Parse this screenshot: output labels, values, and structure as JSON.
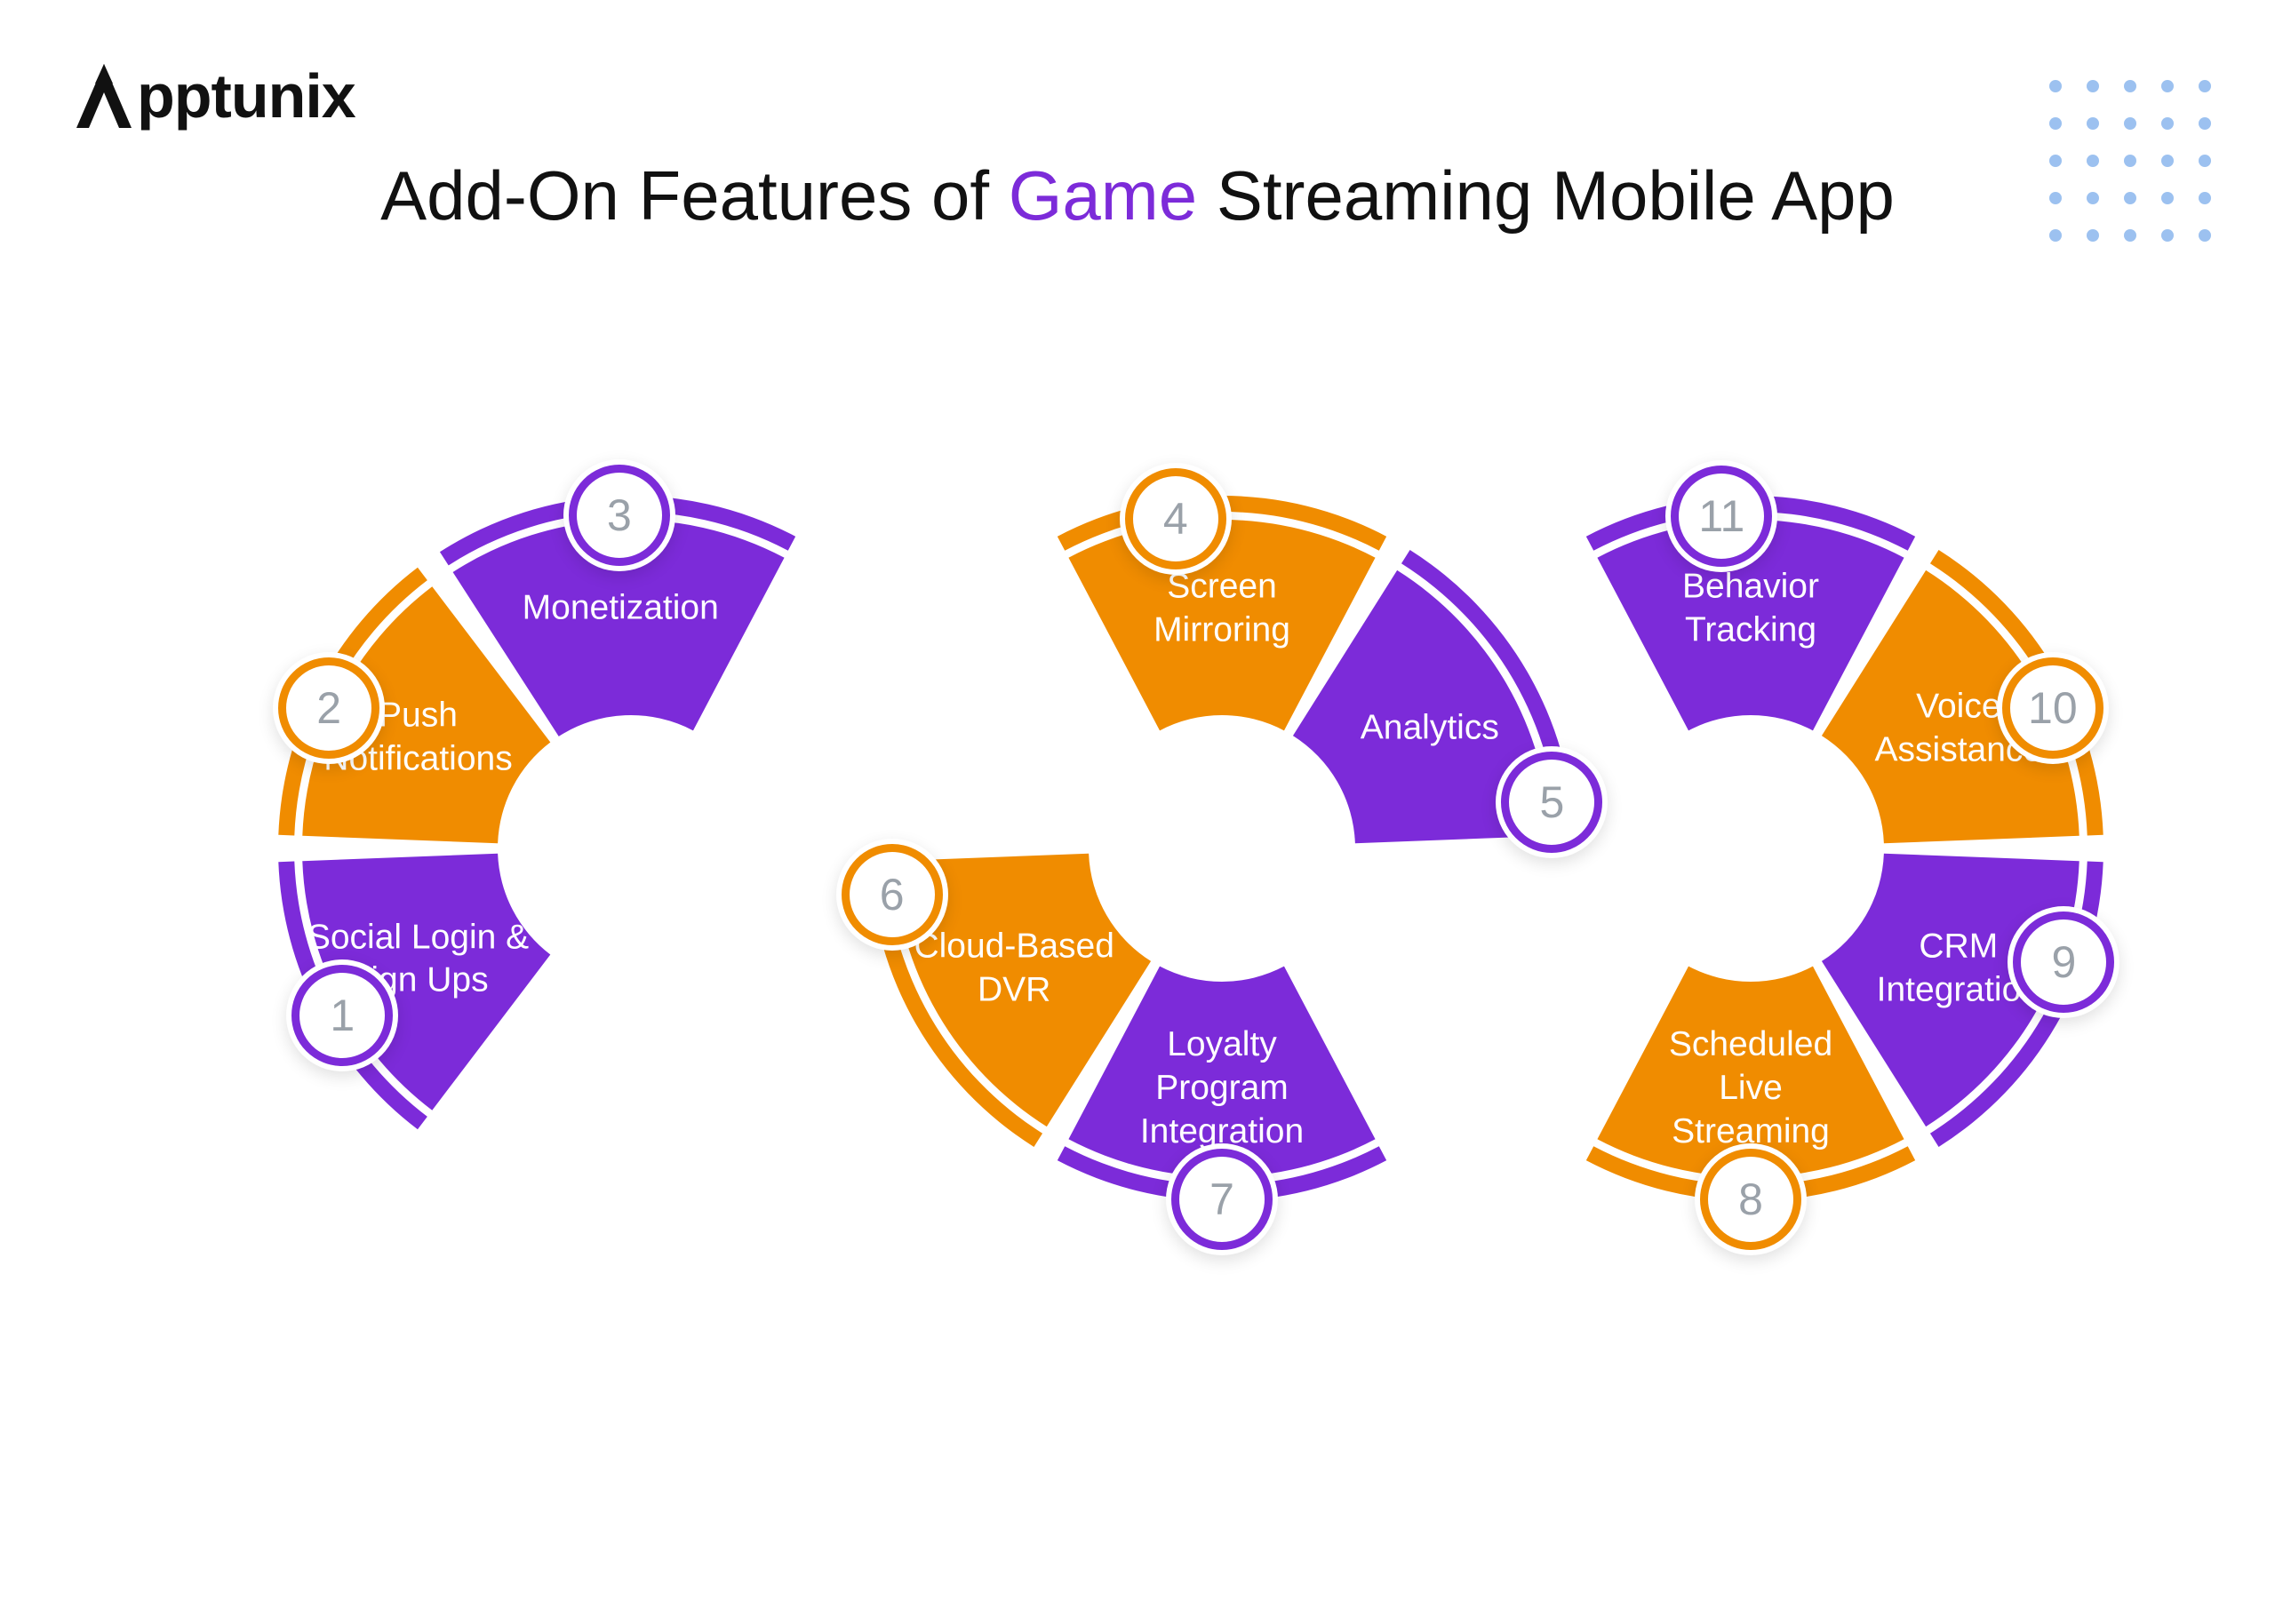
{
  "brand": "pptunix",
  "title_pre": "Add-On Features of ",
  "title_accent": "Game",
  "title_post": " Streaming Mobile App",
  "colors": {
    "purple": "#7c2bd9",
    "orange": "#f08c00"
  },
  "segments": [
    {
      "n": 1,
      "label": "Social Login &\nSign Ups",
      "color": "purple"
    },
    {
      "n": 2,
      "label": "Push\nNotifications",
      "color": "orange"
    },
    {
      "n": 3,
      "label": "Monetization",
      "color": "purple"
    },
    {
      "n": 4,
      "label": "Screen\nMirroring",
      "color": "orange"
    },
    {
      "n": 5,
      "label": "Analytics",
      "color": "purple"
    },
    {
      "n": 6,
      "label": "Cloud-Based\nDVR",
      "color": "orange"
    },
    {
      "n": 7,
      "label": "Loyalty\nProgram\nIntegration",
      "color": "purple"
    },
    {
      "n": 8,
      "label": "Scheduled\nLive\nStreaming",
      "color": "orange"
    },
    {
      "n": 9,
      "label": "CRM\nIntegration",
      "color": "purple"
    },
    {
      "n": 10,
      "label": "Voice\nAssistance",
      "color": "orange"
    },
    {
      "n": 11,
      "label": "Behavior\nTracking",
      "color": "purple"
    }
  ]
}
